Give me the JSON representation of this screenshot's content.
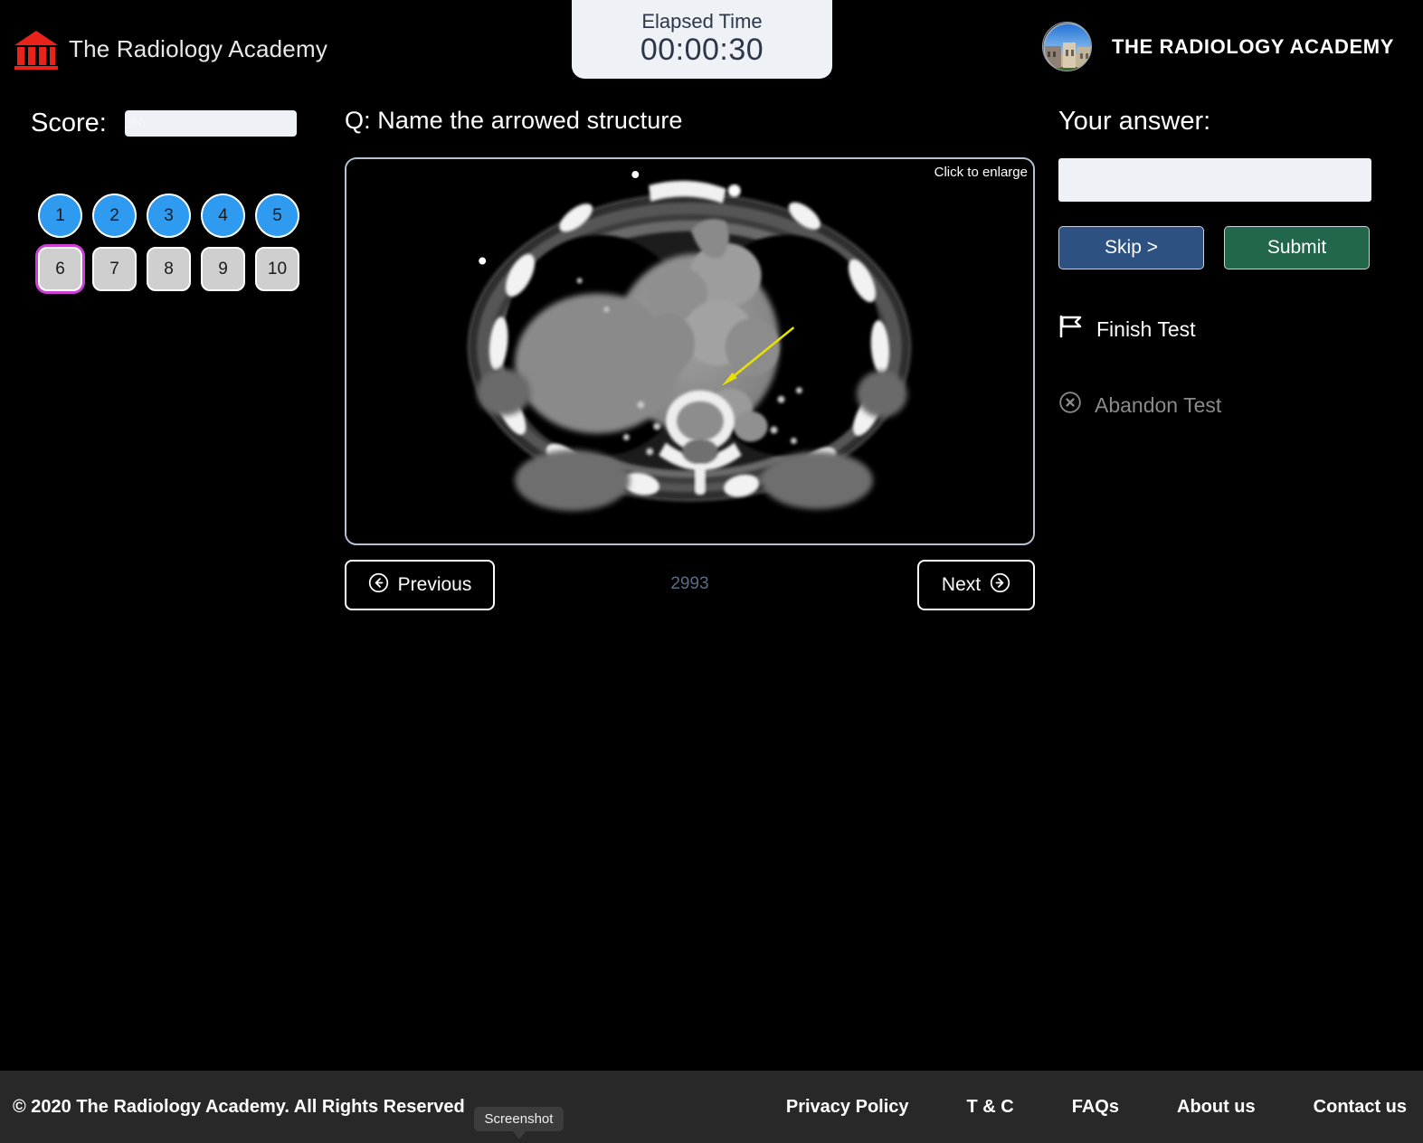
{
  "header": {
    "left_brand": "The Radiology Academy",
    "left_logo_icon": "classical-building-icon",
    "timer_label": "Elapsed Time",
    "timer_value": "00:00:30",
    "right_brand": "THE RADIOLOGY ACADEMY",
    "avatar_icon": "academy-building-avatar"
  },
  "sidebar": {
    "score_label": "Score:",
    "score_value": "0%",
    "questions": [
      {
        "label": "1",
        "state": "answered"
      },
      {
        "label": "2",
        "state": "answered"
      },
      {
        "label": "3",
        "state": "answered"
      },
      {
        "label": "4",
        "state": "answered"
      },
      {
        "label": "5",
        "state": "answered"
      },
      {
        "label": "6",
        "state": "current"
      },
      {
        "label": "7",
        "state": "unanswered"
      },
      {
        "label": "8",
        "state": "unanswered"
      },
      {
        "label": "9",
        "state": "unanswered"
      },
      {
        "label": "10",
        "state": "unanswered"
      }
    ]
  },
  "main": {
    "question": "Q: Name the arrowed structure",
    "enlarge_hint": "Click to enlarge",
    "image_alt": "axial-chest-ct-with-yellow-arrow",
    "case_id": "2993",
    "previous_label": "Previous",
    "next_label": "Next",
    "previous_icon": "circle-arrow-left-icon",
    "next_icon": "circle-arrow-right-icon"
  },
  "answer_panel": {
    "label": "Your answer:",
    "input_value": "",
    "input_placeholder": "",
    "skip_label": "Skip >",
    "submit_label": "Submit",
    "finish_label": "Finish Test",
    "finish_icon": "flag-icon",
    "abandon_label": "Abandon Test",
    "abandon_icon": "circle-x-icon"
  },
  "footer": {
    "copyright": "© 2020 The Radiology Academy. All Rights Reserved",
    "links": [
      "Privacy Policy",
      "T & C",
      "FAQs",
      "About us",
      "Contact us"
    ]
  },
  "overlay": {
    "tooltip": "Screenshot"
  },
  "colors": {
    "answered": "#2e9bf0",
    "unanswered": "#cfcfcf",
    "current_ring": "#cd3fd6",
    "skip": "#2d5282",
    "submit": "#22674a",
    "panel_border": "#b7c1d3",
    "arrow": "#e8e000",
    "logo_red": "#e8241a"
  }
}
